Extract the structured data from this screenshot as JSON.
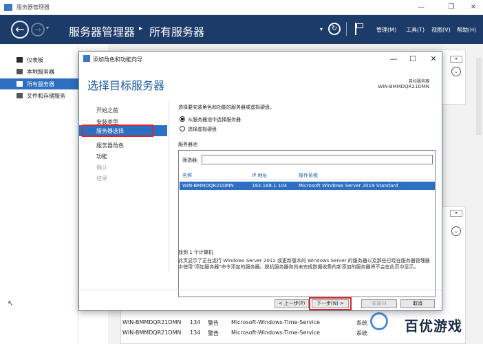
{
  "app": {
    "title": "服务器管理器",
    "controls": {
      "minimize": "—",
      "maximize": "❐",
      "close": "✕"
    }
  },
  "header": {
    "breadcrumb_root": "服务器管理器",
    "breadcrumb_sep": "▸",
    "breadcrumb_current": "所有服务器",
    "menus": [
      "管理(M)",
      "工具(T)",
      "视图(V)",
      "帮助(H)"
    ]
  },
  "sidebar": {
    "items": [
      {
        "label": "仪表板",
        "icon": "dashboard-icon"
      },
      {
        "label": "本地服务器",
        "icon": "server-icon"
      },
      {
        "label": "所有服务器",
        "icon": "servers-icon",
        "active": true
      },
      {
        "label": "文件和存储服务",
        "icon": "storage-icon"
      }
    ]
  },
  "background_events": [
    {
      "server": "WIN-BMMDQR21DMN",
      "id": "134",
      "level": "警告",
      "source": "Microsoft-Windows-Time-Service",
      "category": "系统"
    },
    {
      "server": "WIN-BMMDQR21DMN",
      "id": "134",
      "level": "警告",
      "source": "Microsoft-Windows-Time-Service",
      "category": "系统"
    }
  ],
  "wizard": {
    "title": "添加角色和功能向导",
    "heading": "选择目标服务器",
    "target_label": "目标服务器",
    "target_value": "WIN-BMMDQR21DMN",
    "steps": [
      {
        "label": "开始之前",
        "state": "normal"
      },
      {
        "label": "安装类型",
        "state": "normal"
      },
      {
        "label": "服务器选择",
        "state": "active"
      },
      {
        "label": "服务器角色",
        "state": "normal"
      },
      {
        "label": "功能",
        "state": "normal"
      },
      {
        "label": "确认",
        "state": "disabled"
      },
      {
        "label": "结果",
        "state": "disabled"
      }
    ],
    "instruction": "选择要安装角色和功能的服务器或虚拟硬盘。",
    "option_pool": "从服务器池中选择服务器",
    "option_vhd": "选择虚拟硬盘",
    "pool_title": "服务器池",
    "filter_label": "筛选器:",
    "filter_value": "",
    "columns": {
      "name": "名称",
      "ip": "IP 地址",
      "os": "操作系统"
    },
    "servers": [
      {
        "name": "WIN-BMMDQR21DMN",
        "ip": "192.168.1.104",
        "os": "Microsoft Windows Server 2019 Standard"
      }
    ],
    "found": "找到 1 个计算机",
    "description": "此页显示了正在运行 Windows Server 2012 或更新版本的 Windows Server 的服务器以及那些已经在服务器管理器中使用\"添加服务器\"命令添加的服务器。脱机服务器和尚未完成数据收集的新添加的服务器将不会在此页中显示。",
    "buttons": {
      "prev": "< 上一步(P)",
      "next": "下一步(N) >",
      "install": "安装(I)",
      "cancel": "取消"
    }
  },
  "watermark": {
    "text": "百优游戏"
  }
}
